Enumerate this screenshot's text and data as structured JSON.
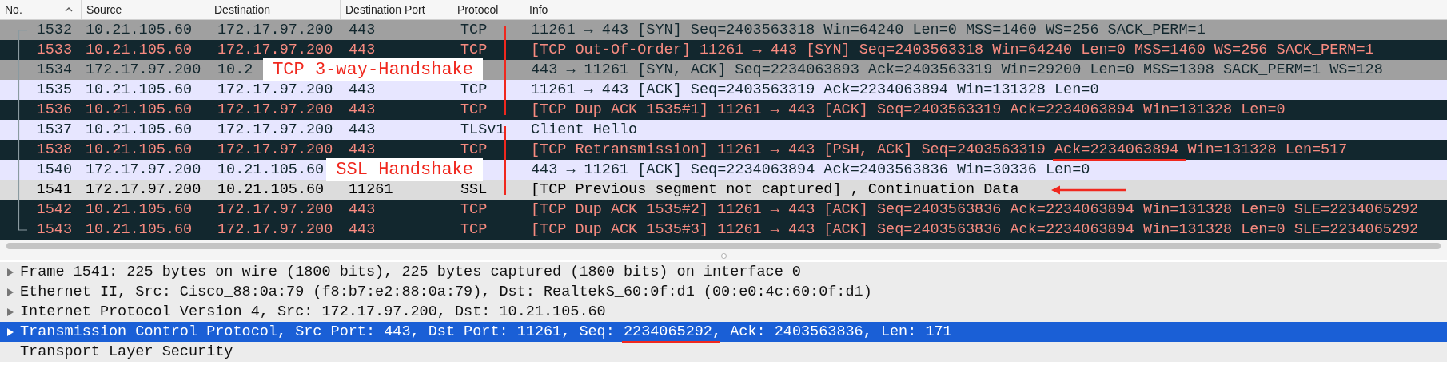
{
  "columns": [
    {
      "label": "No.",
      "sorted": true
    },
    {
      "label": "Source",
      "sorted": false
    },
    {
      "label": "Destination",
      "sorted": false
    },
    {
      "label": "Destination Port",
      "sorted": false
    },
    {
      "label": "Protocol",
      "sorted": false
    },
    {
      "label": "Info",
      "sorted": false
    }
  ],
  "packets": [
    {
      "no": "1532",
      "source": "10.21.105.60",
      "destination": "172.17.97.200",
      "port": "443",
      "protocol": "TCP",
      "info": "11261 → 443 [SYN] Seq=2403563318 Win=64240 Len=0 MSS=1460 WS=256 SACK_PERM=1",
      "kind": "syn",
      "bracket_start": true,
      "bracket_end": false,
      "arrow": false
    },
    {
      "no": "1533",
      "source": "10.21.105.60",
      "destination": "172.17.97.200",
      "port": "443",
      "protocol": "TCP",
      "info": "[TCP Out-Of-Order] 11261 → 443 [SYN] Seq=2403563318 Win=64240 Len=0 MSS=1460 WS=256 SACK_PERM=1",
      "kind": "bad",
      "bracket_start": false,
      "bracket_end": false,
      "arrow": false
    },
    {
      "no": "1534",
      "source": "172.17.97.200",
      "destination": "10.2",
      "info": "443 → 11261 [SYN, ACK] Seq=2234063893 Ack=2403563319 Win=29200 Len=0 MSS=1398 SACK_PERM=1 WS=128",
      "kind": "syn",
      "bracket_start": false,
      "bracket_end": false,
      "arrow": false,
      "label": "TCP 3-way-Handshake"
    },
    {
      "no": "1535",
      "source": "10.21.105.60",
      "destination": "172.17.97.200",
      "port": "443",
      "protocol": "TCP",
      "info": "11261 → 443 [ACK] Seq=2403563319 Ack=2234063894 Win=131328 Len=0",
      "kind": "plain",
      "bracket_start": false,
      "bracket_end": false,
      "arrow": false
    },
    {
      "no": "1536",
      "source": "10.21.105.60",
      "destination": "172.17.97.200",
      "port": "443",
      "protocol": "TCP",
      "info": "[TCP Dup ACK 1535#1] 11261 → 443 [ACK] Seq=2403563319 Ack=2234063894 Win=131328 Len=0",
      "kind": "bad",
      "bracket_start": false,
      "bracket_end": true,
      "arrow": false
    },
    {
      "no": "1537",
      "source": "10.21.105.60",
      "destination": "172.17.97.200",
      "port": "443",
      "protocol": "TLSv1",
      "info": "Client Hello",
      "kind": "plain",
      "bracket_start": true,
      "bracket_end": false,
      "arrow": false
    },
    {
      "no": "1538",
      "source": "10.21.105.60",
      "destination": "172.17.97.200",
      "port": "443",
      "protocol": "TCP",
      "info_parts": [
        {
          "text": "[TCP Retransmission] 11261 → 443 [PSH, ACK] Seq=2403563319 ",
          "underlined": false
        },
        {
          "text": "Ack=2234063894",
          "underlined": true
        },
        {
          "text": " Win=131328 Len=517",
          "underlined": false
        }
      ],
      "kind": "bad",
      "bracket_start": false,
      "bracket_end": false,
      "arrow": false
    },
    {
      "no": "1540",
      "source": "172.17.97.200",
      "destination": "10.21.105.60",
      "info": "443 → 11261 [ACK] Seq=2234063894 Ack=2403563836 Win=30336 Len=0",
      "kind": "plain",
      "bracket_start": false,
      "bracket_end": false,
      "arrow": false,
      "label": "SSL Handshake"
    },
    {
      "no": "1541",
      "source": "172.17.97.200",
      "destination": "10.21.105.60",
      "port": "11261",
      "protocol": "SSL",
      "info": "[TCP Previous segment not captured] , Continuation Data",
      "kind": "ssl",
      "bracket_start": false,
      "bracket_end": true,
      "arrow": true
    },
    {
      "no": "1542",
      "source": "10.21.105.60",
      "destination": "172.17.97.200",
      "port": "443",
      "protocol": "TCP",
      "info": "[TCP Dup ACK 1535#2] 11261 → 443 [ACK] Seq=2403563836 Ack=2234063894 Win=131328 Len=0 SLE=2234065292",
      "kind": "bad",
      "bracket_start": false,
      "bracket_end": false,
      "arrow": false
    },
    {
      "no": "1543",
      "source": "10.21.105.60",
      "destination": "172.17.97.200",
      "port": "443",
      "protocol": "TCP",
      "info": "[TCP Dup ACK 1535#3] 11261 → 443 [ACK] Seq=2403563836 Ack=2234063894 Win=131328 Len=0 SLE=2234065292",
      "kind": "bad",
      "bracket_start": false,
      "bracket_end": false,
      "arrow": false
    }
  ],
  "details": [
    {
      "text": "Frame 1541: 225 bytes on wire (1800 bits), 225 bytes captured (1800 bits) on interface 0",
      "kind": "branch",
      "expanded": false,
      "selected": false
    },
    {
      "text": "Ethernet II, Src: Cisco_88:0a:79 (f8:b7:e2:88:0a:79), Dst: RealtekS_60:0f:d1 (00:e0:4c:60:0f:d1)",
      "kind": "branch",
      "expanded": false,
      "selected": false
    },
    {
      "text": "Internet Protocol Version 4, Src: 172.17.97.200, Dst: 10.21.105.60",
      "kind": "branch",
      "expanded": false,
      "selected": false
    },
    {
      "text_parts": [
        {
          "text": "Transmission Control Protocol, Src Port: 443, Dst Port: 11261, Seq: ",
          "underlined": false
        },
        {
          "text": "2234065292",
          "underlined": true
        },
        {
          "text": ", Ack: 2403563836, Len: 171",
          "underlined": false
        }
      ],
      "kind": "branch",
      "expanded": false,
      "selected": true
    },
    {
      "text": "Transport Layer Security",
      "kind": "leaf",
      "selected": false
    }
  ]
}
